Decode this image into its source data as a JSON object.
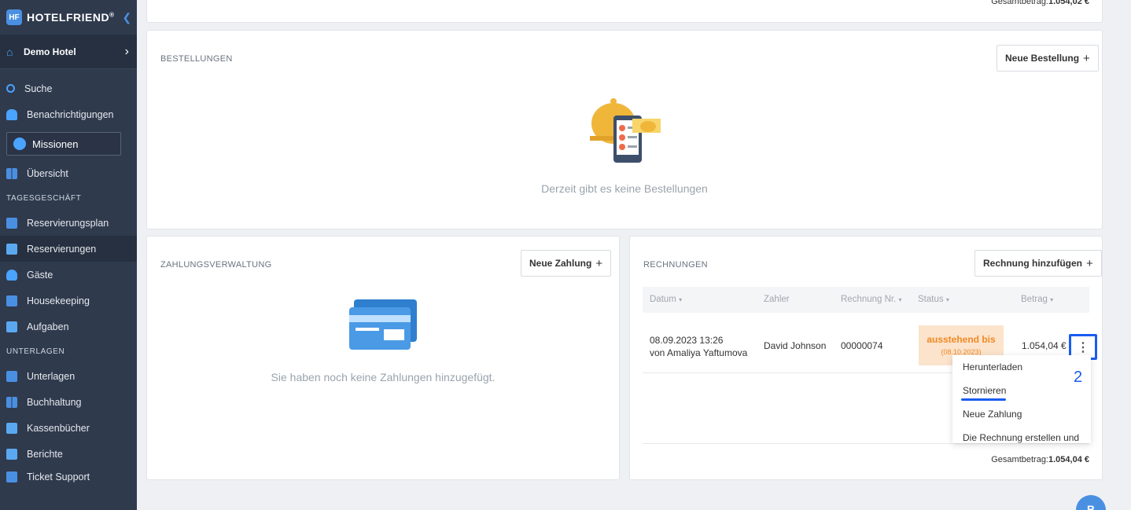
{
  "brand": {
    "logo_mark": "HF",
    "name": "HOTELFRIEND",
    "mark": "®"
  },
  "hotel": {
    "name": "Demo Hotel"
  },
  "nav": {
    "search": "Suche",
    "notifications": "Benachrichtigungen",
    "missions": "Missionen",
    "overview": "Übersicht",
    "section_daily": "TAGESGESCHÄFT",
    "reservation_plan": "Reservierungsplan",
    "reservations": "Reservierungen",
    "guests": "Gäste",
    "housekeeping": "Housekeeping",
    "tasks": "Aufgaben",
    "section_docs": "UNTERLAGEN",
    "documents": "Unterlagen",
    "accounting": "Buchhaltung",
    "cashbooks": "Kassenbücher",
    "reports": "Berichte",
    "ticket_support": "Ticket Support"
  },
  "top_card": {
    "total_label": "Gesamtbetrag:",
    "total_value": "1.054,02 €"
  },
  "orders": {
    "title": "BESTELLUNGEN",
    "new_button": "Neue Bestellung",
    "empty": "Derzeit gibt es keine Bestellungen"
  },
  "payments": {
    "title": "ZAHLUNGSVERWALTUNG",
    "new_button": "Neue Zahlung",
    "empty": "Sie haben noch keine Zahlungen hinzugefügt."
  },
  "invoices": {
    "title": "RECHNUNGEN",
    "add_button": "Rechnung hinzufügen",
    "columns": {
      "date": "Datum",
      "payer": "Zahler",
      "number": "Rechnung Nr.",
      "status": "Status",
      "amount": "Betrag"
    },
    "row": {
      "date": "08.09.2023 13:26",
      "by": "von Amaliya Yaftumova",
      "payer": "David Johnson",
      "number": "00000074",
      "status": "ausstehend bis",
      "status_date": "(08.10.2023)",
      "amount": "1.054,04 €"
    },
    "menu": [
      "Herunterladen",
      "Stornieren",
      "Neue Zahlung",
      "Die Rechnung erstellen und"
    ],
    "total_label": "Gesamtbetrag:",
    "total_value": "1.054,04 €"
  },
  "annotation": {
    "step": "2"
  },
  "fab": {
    "label": "B"
  },
  "colors": {
    "sidebar": "#2f3a4d",
    "accent": "#4a90e2",
    "highlight": "#1a5cf0",
    "status_bg": "#fbe3cc",
    "status_text": "#f08a24"
  }
}
